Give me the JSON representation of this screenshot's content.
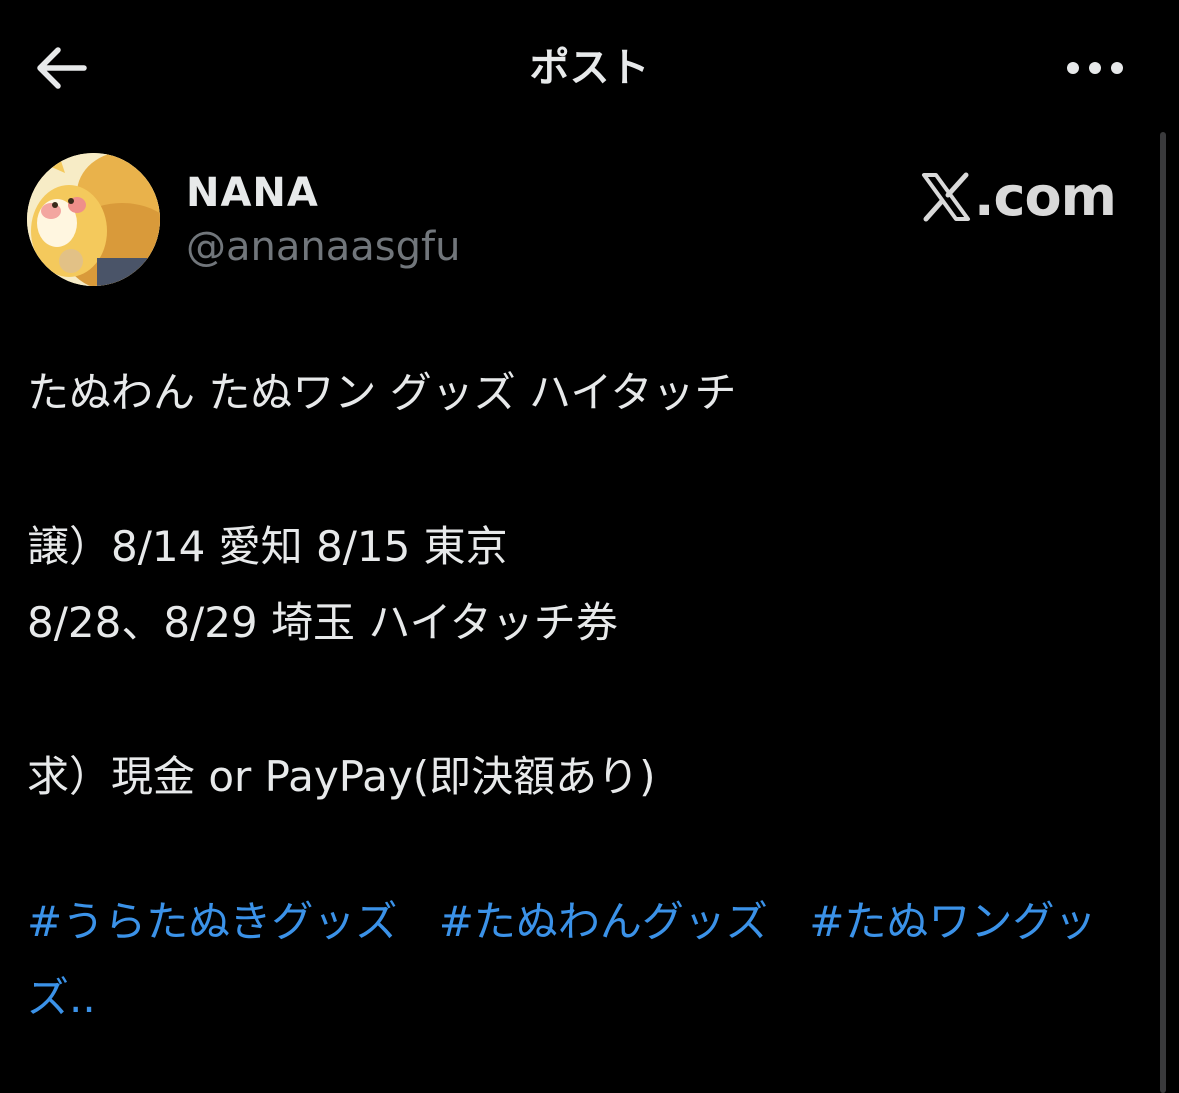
{
  "header": {
    "title": "ポスト",
    "back_icon": "arrow-left-icon",
    "more_icon": "more-horizontal-icon"
  },
  "author": {
    "display_name": "NANA",
    "handle": "@ananaasgfu"
  },
  "brand": {
    "text": ".com",
    "icon": "x-logo-icon"
  },
  "post": {
    "lines": [
      "たぬわん たぬワン グッズ ハイタッチ",
      "譲）8/14 愛知 8/15 東京",
      "8/28、8/29 埼玉 ハイタッチ券",
      "求）現金 or PayPay(即決額あり)"
    ],
    "hashtags": [
      "#うらたぬきグッズ",
      "#たぬわんグッズ",
      "#たぬワングッズ.."
    ]
  },
  "colors": {
    "background": "#000000",
    "text": "#e7e9ea",
    "secondary": "#71767b",
    "link": "#3b92e8"
  }
}
